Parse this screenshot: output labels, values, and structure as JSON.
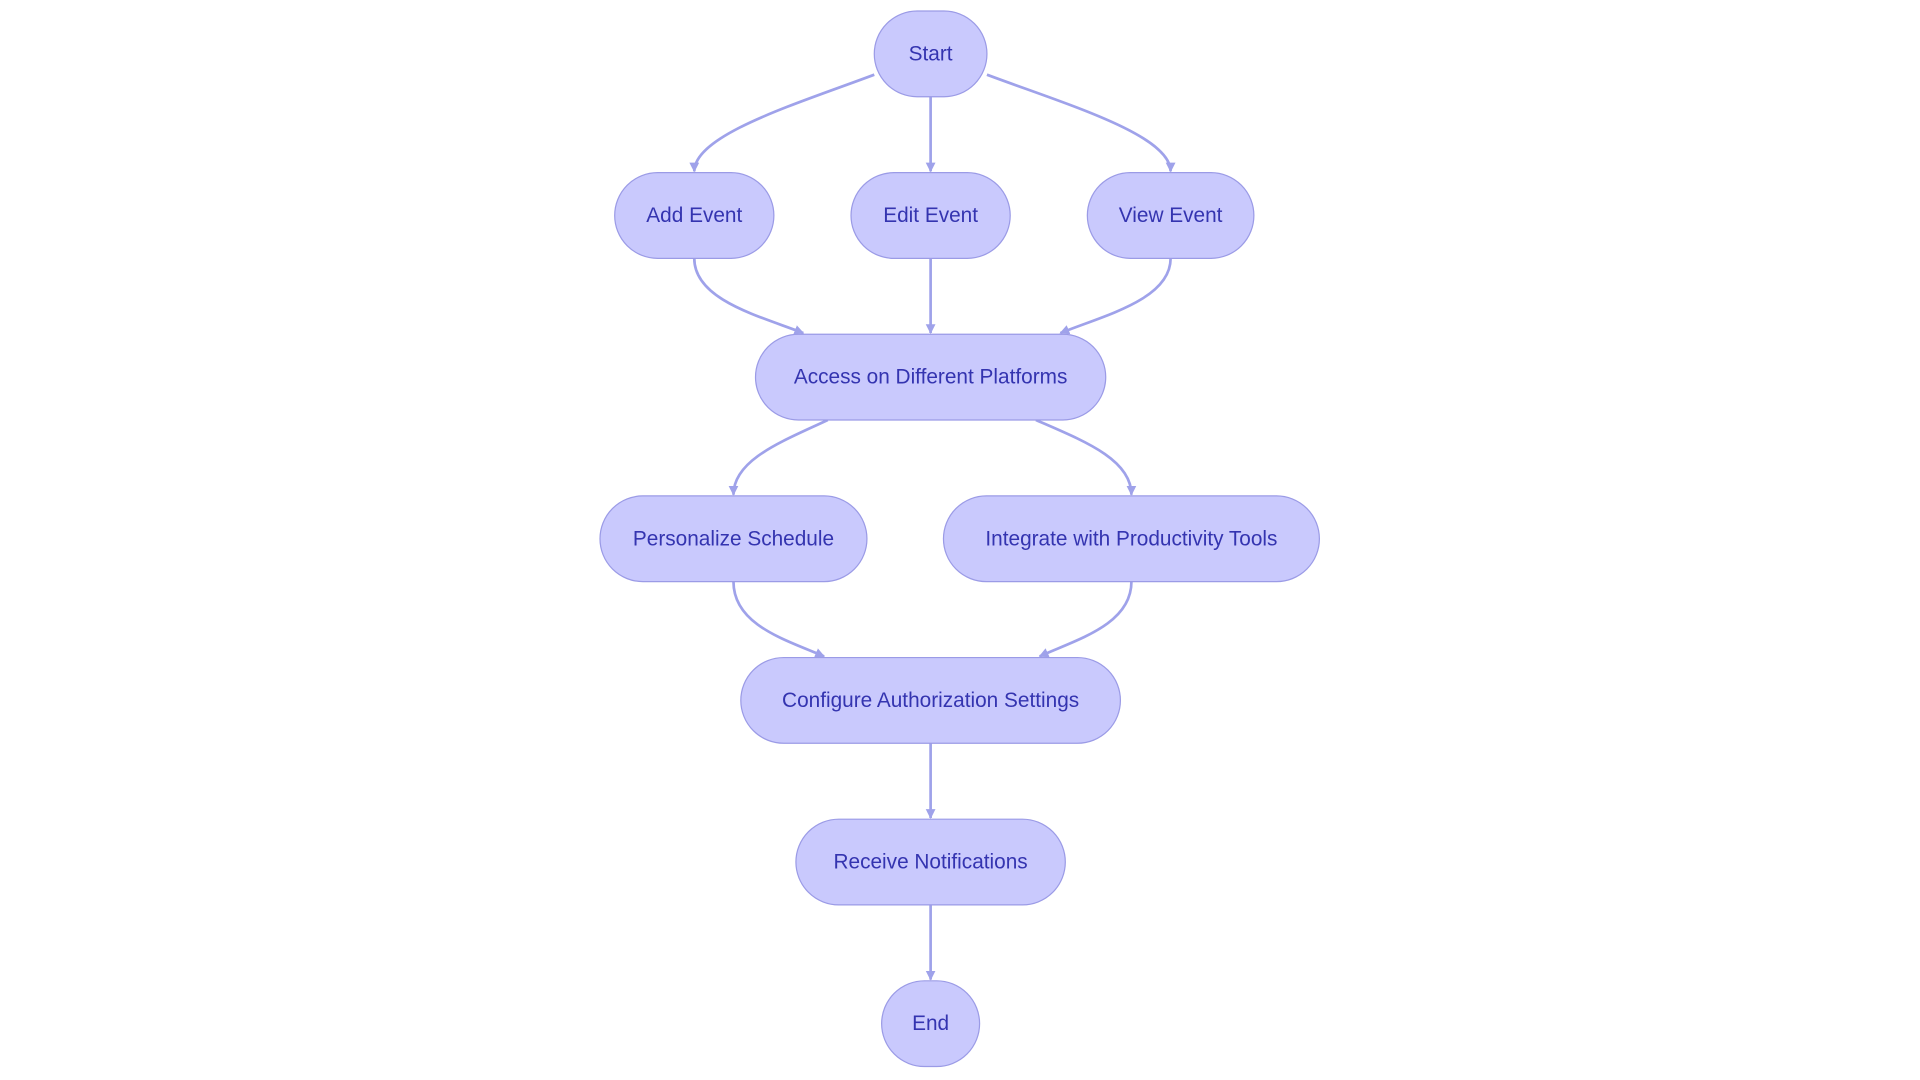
{
  "diagram": {
    "type": "flowchart",
    "colors": {
      "node_fill": "#c9c9fd",
      "node_stroke": "#9b9be6",
      "edge": "#9fa2ea",
      "text": "#3434b0"
    },
    "nodes": [
      {
        "id": "start",
        "label": "Start"
      },
      {
        "id": "add",
        "label": "Add Event"
      },
      {
        "id": "edit",
        "label": "Edit Event"
      },
      {
        "id": "view",
        "label": "View Event"
      },
      {
        "id": "access",
        "label": "Access on Different Platforms"
      },
      {
        "id": "personalize",
        "label": "Personalize Schedule"
      },
      {
        "id": "integrate",
        "label": "Integrate with Productivity Tools"
      },
      {
        "id": "configure",
        "label": "Configure Authorization Settings"
      },
      {
        "id": "receive",
        "label": "Receive Notifications"
      },
      {
        "id": "end",
        "label": "End"
      }
    ],
    "edges": [
      {
        "from": "start",
        "to": "add"
      },
      {
        "from": "start",
        "to": "edit"
      },
      {
        "from": "start",
        "to": "view"
      },
      {
        "from": "add",
        "to": "access"
      },
      {
        "from": "edit",
        "to": "access"
      },
      {
        "from": "view",
        "to": "access"
      },
      {
        "from": "access",
        "to": "personalize"
      },
      {
        "from": "access",
        "to": "integrate"
      },
      {
        "from": "personalize",
        "to": "configure"
      },
      {
        "from": "integrate",
        "to": "configure"
      },
      {
        "from": "configure",
        "to": "receive"
      },
      {
        "from": "receive",
        "to": "end"
      }
    ]
  }
}
